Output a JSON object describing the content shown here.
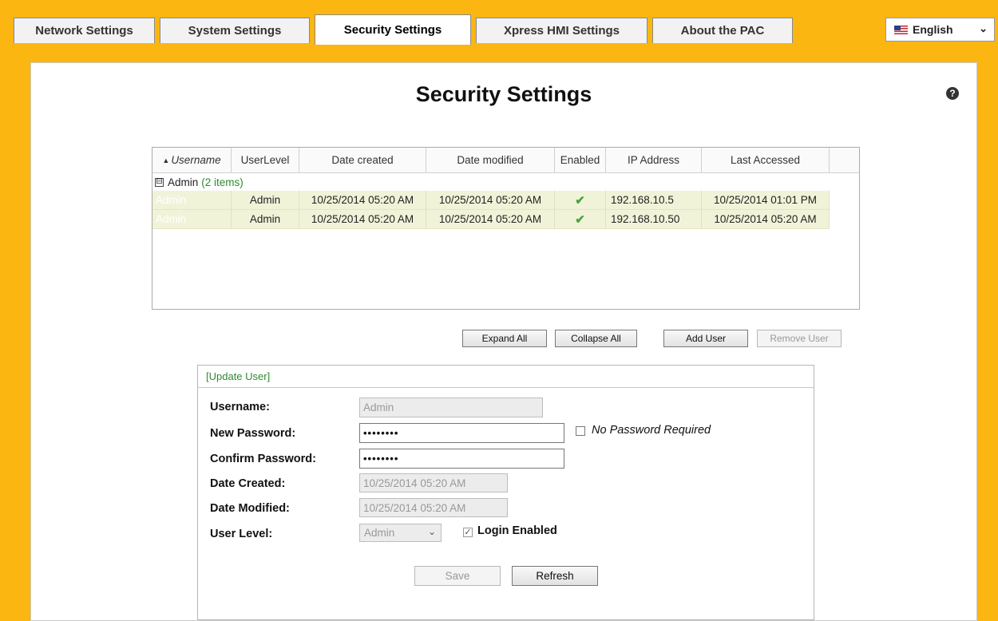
{
  "tabs": [
    {
      "label": "Network Settings",
      "active": false
    },
    {
      "label": "System Settings",
      "active": false
    },
    {
      "label": "Security Settings",
      "active": true
    },
    {
      "label": "Xpress HMI Settings",
      "active": false
    },
    {
      "label": "About the PAC",
      "active": false
    }
  ],
  "language": {
    "selected": "English",
    "icon": "us-flag-icon"
  },
  "page": {
    "title": "Security Settings",
    "help_icon": "?"
  },
  "grid": {
    "columns": [
      "Username",
      "UserLevel",
      "Date created",
      "Date modified",
      "Enabled",
      "IP Address",
      "Last Accessed"
    ],
    "sorted_column": "Username",
    "group": {
      "name": "Admin",
      "count_label": "(2 items)",
      "toggle": "⊟"
    },
    "rows": [
      {
        "username": "Admin",
        "userlevel": "Admin",
        "date_created": "10/25/2014 05:20 AM",
        "date_modified": "10/25/2014 05:20 AM",
        "enabled": "✔",
        "ip": "192.168.10.5",
        "last_accessed": "10/25/2014 01:01 PM"
      },
      {
        "username": "Admin",
        "userlevel": "Admin",
        "date_created": "10/25/2014 05:20 AM",
        "date_modified": "10/25/2014 05:20 AM",
        "enabled": "✔",
        "ip": "192.168.10.50",
        "last_accessed": "10/25/2014 05:20 AM"
      }
    ]
  },
  "actions": {
    "expand_all": "Expand All",
    "collapse_all": "Collapse All",
    "add_user": "Add User",
    "remove_user": "Remove User"
  },
  "form": {
    "legend": "[Update User]",
    "username_label": "Username:",
    "username_value": "Admin",
    "new_password_label": "New Password:",
    "new_password_value": "••••••••",
    "no_password_label": "No Password Required",
    "confirm_password_label": "Confirm Password:",
    "confirm_password_value": "••••••••",
    "date_created_label": "Date Created:",
    "date_created_value": "10/25/2014 05:20 AM",
    "date_modified_label": "Date Modified:",
    "date_modified_value": "10/25/2014 05:20 AM",
    "user_level_label": "User Level:",
    "user_level_value": "Admin",
    "login_enabled_label": "Login Enabled",
    "login_enabled_checked": true,
    "save_label": "Save",
    "refresh_label": "Refresh"
  },
  "colors": {
    "accent": "#fbb611",
    "row_highlight": "#f1f3d9",
    "legend_green": "#2e8b2e"
  }
}
